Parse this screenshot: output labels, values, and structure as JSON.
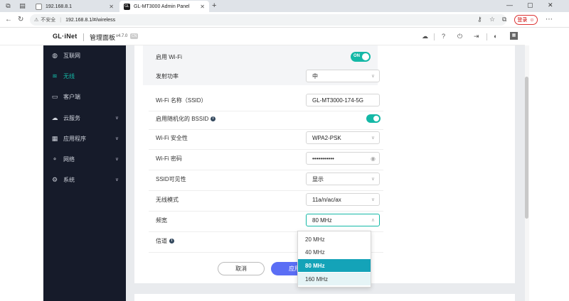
{
  "browser": {
    "tabs": [
      {
        "title": "192.168.8.1",
        "active": false
      },
      {
        "title": "GL-MT3000 Admin Panel",
        "active": true
      }
    ],
    "address": {
      "security": "不安全",
      "url": "192.168.8.1/#/wireless"
    },
    "login_label": "登录",
    "icons": [
      "workspaces-icon",
      "tab-list-icon",
      "back-icon",
      "refresh-icon",
      "key-icon",
      "read-aloud-icon",
      "favorite-icon",
      "collections-icon",
      "more-icon"
    ]
  },
  "header": {
    "logo": "GL·iNet",
    "title": "管理面板",
    "version": "v4.7.0",
    "lang_badge": "CN"
  },
  "sidebar": {
    "items": [
      {
        "label": "互联网",
        "icon": "internet-icon",
        "active": false,
        "chevron": false
      },
      {
        "label": "无线",
        "icon": "wifi-icon",
        "active": true,
        "chevron": false
      },
      {
        "label": "客户端",
        "icon": "clients-icon",
        "active": false,
        "chevron": false
      },
      {
        "label": "云服务",
        "icon": "cloud-icon",
        "active": false,
        "chevron": true
      },
      {
        "label": "应用程序",
        "icon": "apps-icon",
        "active": false,
        "chevron": true
      },
      {
        "label": "网络",
        "icon": "network-icon",
        "active": false,
        "chevron": true
      },
      {
        "label": "系统",
        "icon": "system-icon",
        "active": false,
        "chevron": true
      }
    ]
  },
  "form": {
    "enable_wifi": {
      "label": "启用 Wi-Fi",
      "toggle_text": "ON"
    },
    "tx_power": {
      "label": "发射功率",
      "value": "中"
    },
    "ssid": {
      "label": "Wi-Fi 名称（SSID）",
      "value": "GL-MT3000-174-5G"
    },
    "random_bssid": {
      "label": "启用随机化的 BSSID"
    },
    "security": {
      "label": "Wi-Fi 安全性",
      "value": "WPA2-PSK"
    },
    "password": {
      "label": "Wi-Fi 密码",
      "value": "•••••••••••"
    },
    "ssid_visibility": {
      "label": "SSID可见性",
      "value": "显示"
    },
    "wireless_mode": {
      "label": "无线模式",
      "value": "11a/n/ac/ax"
    },
    "bandwidth": {
      "label": "频宽",
      "value": "80 MHz"
    },
    "channel": {
      "label": "信道"
    },
    "cancel_label": "取消",
    "apply_label": "应用"
  },
  "bandwidth_dropdown": {
    "options": [
      "20 MHz",
      "40 MHz",
      "80 MHz",
      "160 MHz"
    ],
    "selected": "80 MHz"
  },
  "colors": {
    "accent": "#14b8a6",
    "sidebar_bg": "#161b2a",
    "apply": "#5b6ef5",
    "selected_option": "#14a3b8"
  }
}
